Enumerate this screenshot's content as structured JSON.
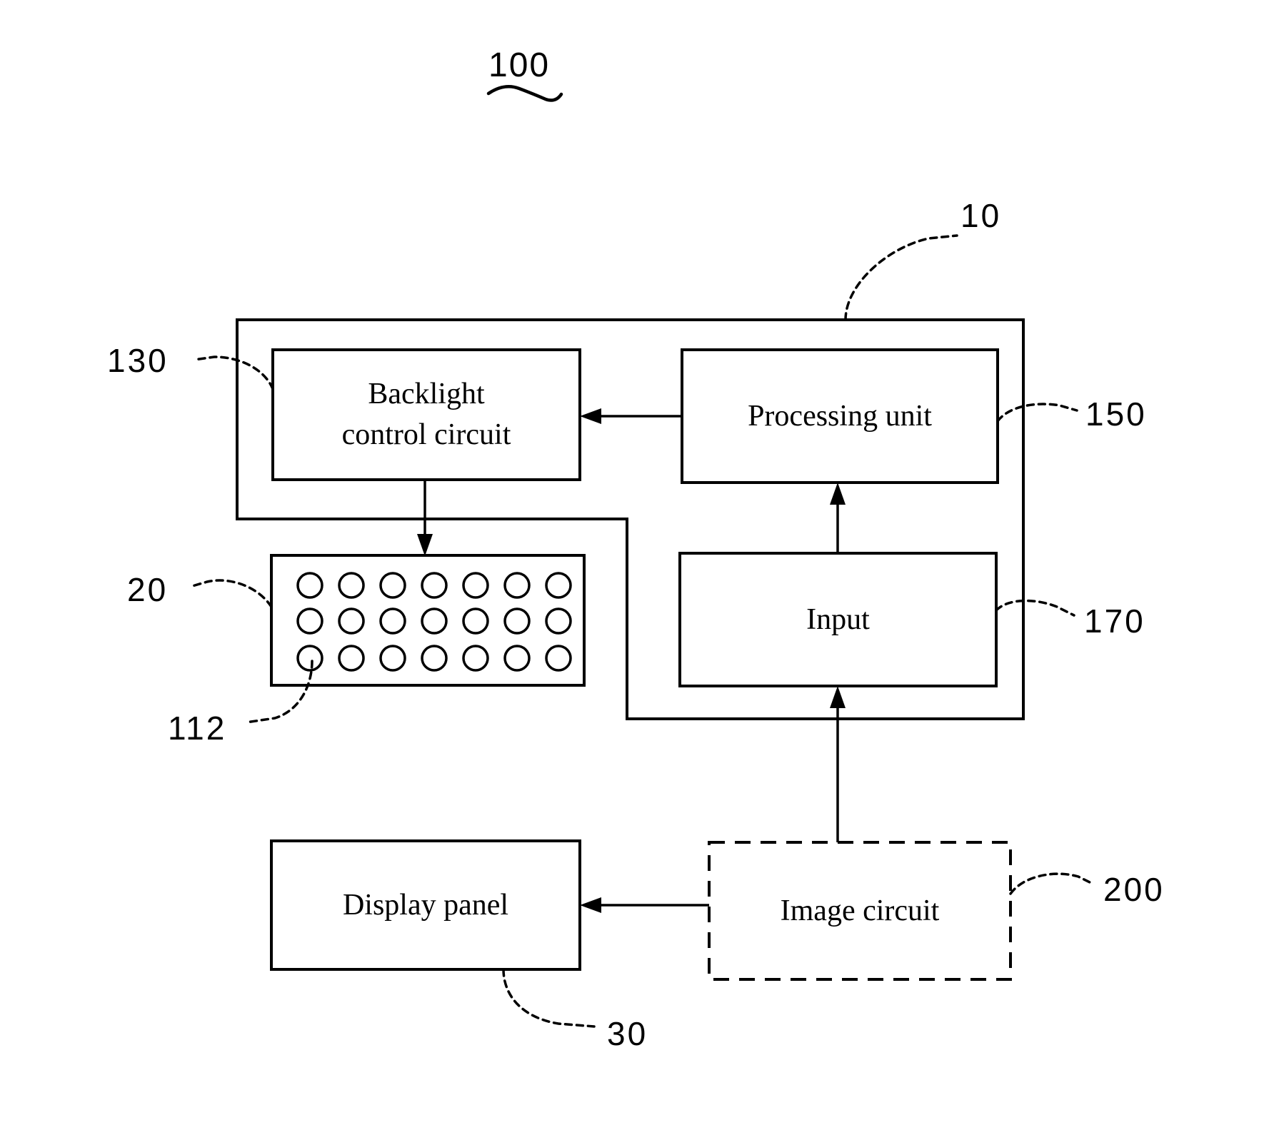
{
  "figure": {
    "number": "100",
    "type": "patent-block-diagram",
    "description": "Display device block diagram with backlight control, LED array, processing unit, input, display panel and image circuit"
  },
  "blocks": {
    "backlight_control": {
      "label_line1": "Backlight",
      "label_line2": "control circuit",
      "ref": "130",
      "border": "solid"
    },
    "processing_unit": {
      "label": "Processing unit",
      "ref": "150",
      "border": "solid"
    },
    "led_array": {
      "ref": "20",
      "led_ref": "112",
      "rows": 3,
      "cols": 7,
      "border": "solid"
    },
    "input": {
      "label": "Input",
      "ref": "170",
      "border": "solid"
    },
    "display_panel": {
      "label": "Display panel",
      "ref": "30",
      "border": "solid"
    },
    "image_circuit": {
      "label": "Image circuit",
      "ref": "200",
      "border": "dashed"
    },
    "enclosure": {
      "ref": "10",
      "border": "solid"
    }
  },
  "connections": [
    {
      "from": "processing_unit",
      "to": "backlight_control",
      "direction": "left"
    },
    {
      "from": "backlight_control",
      "to": "led_array",
      "direction": "down"
    },
    {
      "from": "input",
      "to": "processing_unit",
      "direction": "up"
    },
    {
      "from": "image_circuit",
      "to": "input",
      "direction": "up"
    },
    {
      "from": "image_circuit",
      "to": "display_panel",
      "direction": "left"
    }
  ],
  "colors": {
    "line": "#000000",
    "background": "#ffffff"
  }
}
